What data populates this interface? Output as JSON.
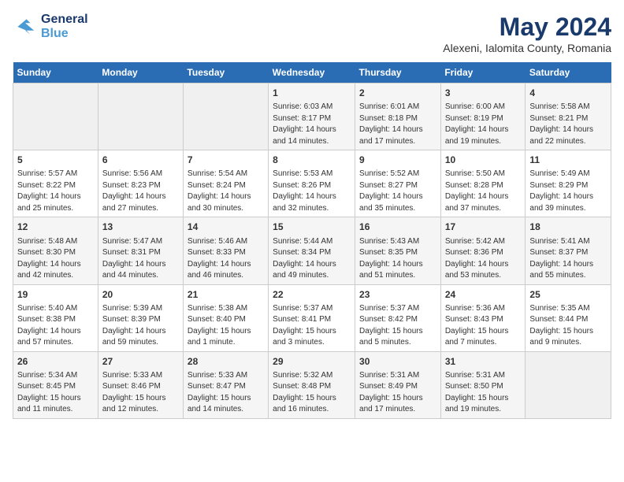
{
  "header": {
    "logo_line1": "General",
    "logo_line2": "Blue",
    "title": "May 2024",
    "subtitle": "Alexeni, Ialomita County, Romania"
  },
  "columns": [
    "Sunday",
    "Monday",
    "Tuesday",
    "Wednesday",
    "Thursday",
    "Friday",
    "Saturday"
  ],
  "weeks": [
    [
      {
        "day": "",
        "info": ""
      },
      {
        "day": "",
        "info": ""
      },
      {
        "day": "",
        "info": ""
      },
      {
        "day": "1",
        "info": "Sunrise: 6:03 AM\nSunset: 8:17 PM\nDaylight: 14 hours\nand 14 minutes."
      },
      {
        "day": "2",
        "info": "Sunrise: 6:01 AM\nSunset: 8:18 PM\nDaylight: 14 hours\nand 17 minutes."
      },
      {
        "day": "3",
        "info": "Sunrise: 6:00 AM\nSunset: 8:19 PM\nDaylight: 14 hours\nand 19 minutes."
      },
      {
        "day": "4",
        "info": "Sunrise: 5:58 AM\nSunset: 8:21 PM\nDaylight: 14 hours\nand 22 minutes."
      }
    ],
    [
      {
        "day": "5",
        "info": "Sunrise: 5:57 AM\nSunset: 8:22 PM\nDaylight: 14 hours\nand 25 minutes."
      },
      {
        "day": "6",
        "info": "Sunrise: 5:56 AM\nSunset: 8:23 PM\nDaylight: 14 hours\nand 27 minutes."
      },
      {
        "day": "7",
        "info": "Sunrise: 5:54 AM\nSunset: 8:24 PM\nDaylight: 14 hours\nand 30 minutes."
      },
      {
        "day": "8",
        "info": "Sunrise: 5:53 AM\nSunset: 8:26 PM\nDaylight: 14 hours\nand 32 minutes."
      },
      {
        "day": "9",
        "info": "Sunrise: 5:52 AM\nSunset: 8:27 PM\nDaylight: 14 hours\nand 35 minutes."
      },
      {
        "day": "10",
        "info": "Sunrise: 5:50 AM\nSunset: 8:28 PM\nDaylight: 14 hours\nand 37 minutes."
      },
      {
        "day": "11",
        "info": "Sunrise: 5:49 AM\nSunset: 8:29 PM\nDaylight: 14 hours\nand 39 minutes."
      }
    ],
    [
      {
        "day": "12",
        "info": "Sunrise: 5:48 AM\nSunset: 8:30 PM\nDaylight: 14 hours\nand 42 minutes."
      },
      {
        "day": "13",
        "info": "Sunrise: 5:47 AM\nSunset: 8:31 PM\nDaylight: 14 hours\nand 44 minutes."
      },
      {
        "day": "14",
        "info": "Sunrise: 5:46 AM\nSunset: 8:33 PM\nDaylight: 14 hours\nand 46 minutes."
      },
      {
        "day": "15",
        "info": "Sunrise: 5:44 AM\nSunset: 8:34 PM\nDaylight: 14 hours\nand 49 minutes."
      },
      {
        "day": "16",
        "info": "Sunrise: 5:43 AM\nSunset: 8:35 PM\nDaylight: 14 hours\nand 51 minutes."
      },
      {
        "day": "17",
        "info": "Sunrise: 5:42 AM\nSunset: 8:36 PM\nDaylight: 14 hours\nand 53 minutes."
      },
      {
        "day": "18",
        "info": "Sunrise: 5:41 AM\nSunset: 8:37 PM\nDaylight: 14 hours\nand 55 minutes."
      }
    ],
    [
      {
        "day": "19",
        "info": "Sunrise: 5:40 AM\nSunset: 8:38 PM\nDaylight: 14 hours\nand 57 minutes."
      },
      {
        "day": "20",
        "info": "Sunrise: 5:39 AM\nSunset: 8:39 PM\nDaylight: 14 hours\nand 59 minutes."
      },
      {
        "day": "21",
        "info": "Sunrise: 5:38 AM\nSunset: 8:40 PM\nDaylight: 15 hours\nand 1 minute."
      },
      {
        "day": "22",
        "info": "Sunrise: 5:37 AM\nSunset: 8:41 PM\nDaylight: 15 hours\nand 3 minutes."
      },
      {
        "day": "23",
        "info": "Sunrise: 5:37 AM\nSunset: 8:42 PM\nDaylight: 15 hours\nand 5 minutes."
      },
      {
        "day": "24",
        "info": "Sunrise: 5:36 AM\nSunset: 8:43 PM\nDaylight: 15 hours\nand 7 minutes."
      },
      {
        "day": "25",
        "info": "Sunrise: 5:35 AM\nSunset: 8:44 PM\nDaylight: 15 hours\nand 9 minutes."
      }
    ],
    [
      {
        "day": "26",
        "info": "Sunrise: 5:34 AM\nSunset: 8:45 PM\nDaylight: 15 hours\nand 11 minutes."
      },
      {
        "day": "27",
        "info": "Sunrise: 5:33 AM\nSunset: 8:46 PM\nDaylight: 15 hours\nand 12 minutes."
      },
      {
        "day": "28",
        "info": "Sunrise: 5:33 AM\nSunset: 8:47 PM\nDaylight: 15 hours\nand 14 minutes."
      },
      {
        "day": "29",
        "info": "Sunrise: 5:32 AM\nSunset: 8:48 PM\nDaylight: 15 hours\nand 16 minutes."
      },
      {
        "day": "30",
        "info": "Sunrise: 5:31 AM\nSunset: 8:49 PM\nDaylight: 15 hours\nand 17 minutes."
      },
      {
        "day": "31",
        "info": "Sunrise: 5:31 AM\nSunset: 8:50 PM\nDaylight: 15 hours\nand 19 minutes."
      },
      {
        "day": "",
        "info": ""
      }
    ]
  ]
}
